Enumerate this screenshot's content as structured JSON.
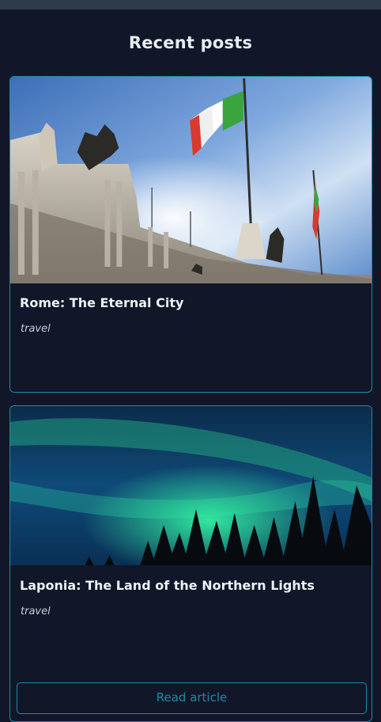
{
  "section": {
    "title": "Recent posts"
  },
  "posts": [
    {
      "title": "Rome: The Eternal City",
      "tag": "travel",
      "image": "rome-monument-flag-photo"
    },
    {
      "title": "Laponia: The Land of the Northern Lights",
      "tag": "travel",
      "image": "northern-lights-forest-photo",
      "button_label": "Read article"
    }
  ],
  "colors": {
    "background": "#111728",
    "accent": "#1d8aa6",
    "top_bar": "#2f3a4a"
  }
}
